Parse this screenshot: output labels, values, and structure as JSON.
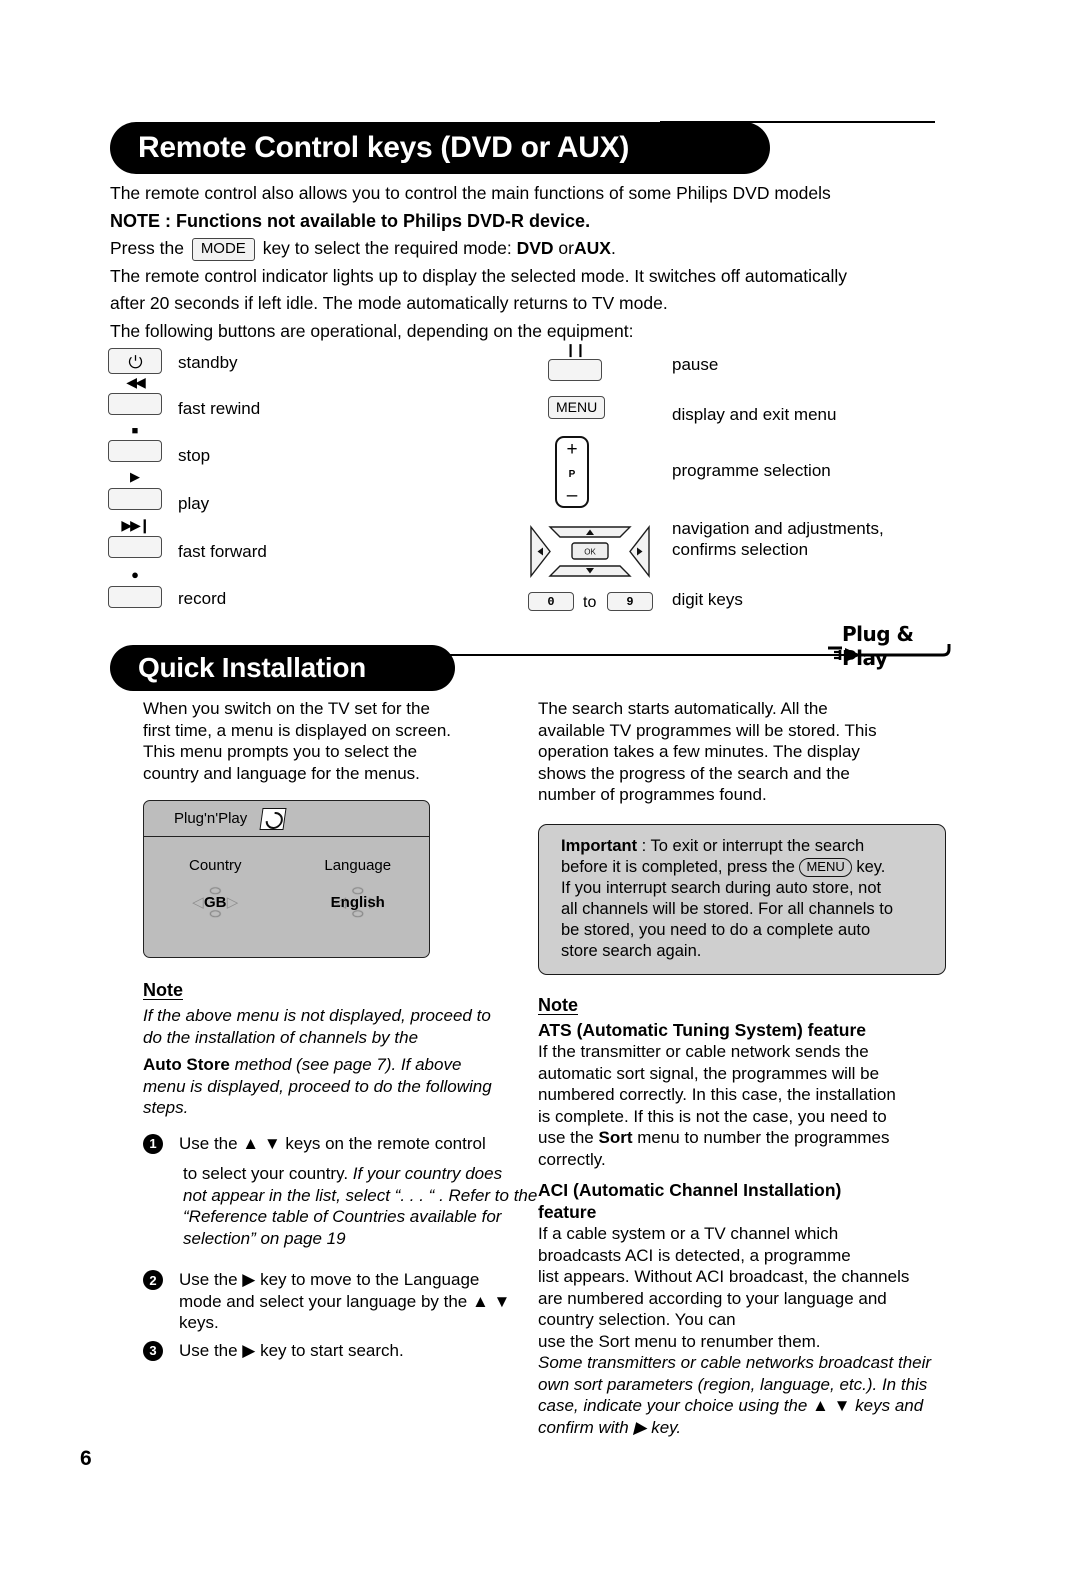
{
  "page": {
    "number": "6"
  },
  "sections": {
    "remote": {
      "banner_title": "Remote Control keys (DVD or AUX)",
      "intro_line1": "The remote control also allows you to control the main functions of some Philips DVD models",
      "note_line": "NOTE : Functions not available to Philips DVD-R device.",
      "press_prefix": "Press the",
      "mode_key": "MODE",
      "press_mid": "key to select the required mode:",
      "press_dvd": "DVD",
      "press_or": "or",
      "press_aux": "AUX",
      "press_end": ".",
      "indicator_line1": "The remote control indicator lights up to display the selected mode. It switches off automatically",
      "indicator_line2": "after 20 seconds if left idle. The mode automatically returns to TV mode.",
      "buttons_intro": "The following buttons are operational, depending on the equipment:",
      "keys_left": [
        {
          "glyph": "⏻",
          "label": "standby",
          "icon_name": "power-icon"
        },
        {
          "glyph": "⏮◀",
          "label": "fast rewind",
          "icon_name": "fast-rewind-icon"
        },
        {
          "glyph": "■",
          "label": "stop",
          "icon_name": "stop-icon"
        },
        {
          "glyph": "▶",
          "label": "play",
          "icon_name": "play-icon"
        },
        {
          "glyph": "▶▶❘",
          "label": "fast forward",
          "icon_name": "fast-forward-icon"
        },
        {
          "glyph": "●",
          "label": "record",
          "icon_name": "record-icon"
        }
      ],
      "keys_right": {
        "pause_glyph": "❘❘",
        "pause_label": "pause",
        "menu_key": "MENU",
        "menu_label": "display and exit menu",
        "p_plus": "+",
        "p_letter": "P",
        "p_minus": "–",
        "p_label": "programme selection",
        "nav_ok": "OK",
        "nav_label_line1": "navigation and adjustments,",
        "nav_label_line2": "confirms selection",
        "digit_from": "0",
        "digit_to_word": "to",
        "digit_to": "9",
        "digit_label": "digit keys"
      }
    },
    "quick_install": {
      "banner_title": "Quick Installation",
      "plug_play_logo": "Plug & Play",
      "left": {
        "intro": [
          "When you switch on the TV set for the",
          "first time, a menu is displayed on screen.",
          "This menu prompts you to select the",
          "country and language for the menus."
        ],
        "osd": {
          "title": "Plug'n'Play",
          "icon_name": "plug-n-play-icon",
          "country_head": "Country",
          "country_value": "GB",
          "language_head": "Language",
          "language_value": "English"
        },
        "note_head": "Note",
        "note_lines": [
          "If the above menu is not displayed, proceed to",
          "do the installation of channels by the"
        ],
        "note_bold_term": "Auto Store",
        "note_lines2": [
          " method (see page 7). If above",
          "menu is displayed, proceed to do the following",
          "steps."
        ],
        "steps": [
          {
            "num": "❶",
            "lines_plain": [
              "Use the ▲ ▼ keys on the remote control"
            ],
            "lines_italic": [
              "to select your country. If your country does",
              "not appear in the list, select “. . . “ . Refer to the",
              "“Reference table of Countries available for",
              "selection” on page 19"
            ],
            "plain_prefix": "to select your country. "
          },
          {
            "num": "❷",
            "lines_plain": [
              "Use the ▶  key to move to the Language",
              "mode and select your language by the ▲ ▼",
              "keys."
            ],
            "lines_italic": []
          },
          {
            "num": "❸",
            "lines_plain": [
              "Use the ▶ key to start search."
            ],
            "lines_italic": []
          }
        ]
      },
      "right": {
        "search_para": [
          "The search starts automatically. All the",
          "available TV programmes will be stored. This",
          "operation takes a few minutes. The display",
          "shows the progress of the search and the",
          "number of programmes found."
        ],
        "important": {
          "label": "Important",
          "line1_rest": " : To exit or interrupt the search",
          "line2_a": "before it is completed, press the ",
          "menu_key": "MENU",
          "line2_b": " key.",
          "line3": "If you interrupt search during auto store, not",
          "line4": "all channels will be stored. For all channels to",
          "line5": "be stored, you need to do a complete auto",
          "line6": "store search again."
        },
        "note_head": "Note",
        "ats_head": "ATS (Automatic Tuning System) feature",
        "ats_lines": [
          "If the transmitter or cable network sends the",
          "automatic sort signal, the programmes will be",
          "numbered correctly. In this case, the installation",
          "is complete. If this is not the case, you need to"
        ],
        "ats_line_sort_a": "use the ",
        "ats_sort_bold": "Sort",
        "ats_line_sort_b": " menu to number the programmes",
        "ats_last": "correctly.",
        "aci_head_line1": "ACI (Automatic Channel Installation)",
        "aci_head_line2": "feature",
        "aci_lines": [
          "If a cable system or a TV channel which",
          "broadcasts ACI is detected, a programme",
          "list appears. Without ACI broadcast, the channels",
          "are numbered according to your language and",
          "country selection. You can",
          "use the Sort menu to renumber them."
        ],
        "aci_italic_lines": [
          "Some transmitters or cable networks broadcast their",
          "own sort parameters (region, language, etc.). In this",
          "case, indicate your choice using the ▲ ▼ keys and",
          "confirm with ▶ key."
        ]
      }
    }
  }
}
